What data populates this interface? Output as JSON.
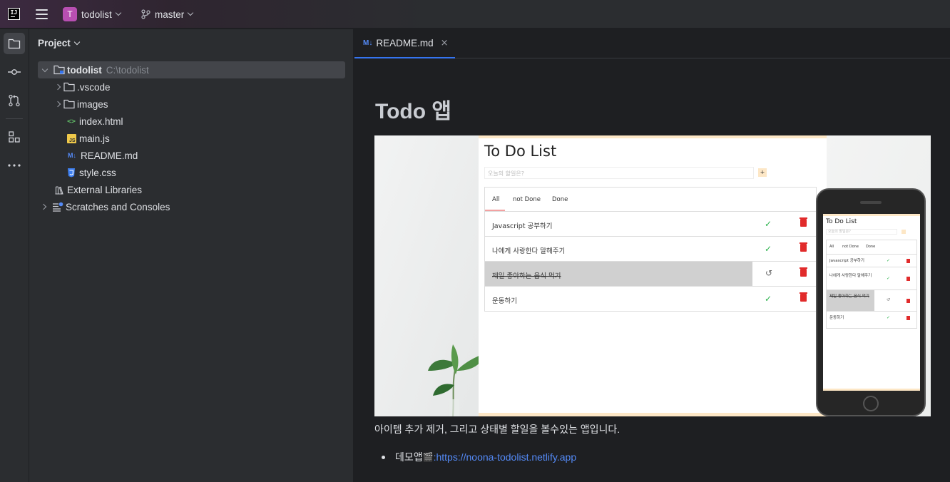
{
  "titlebar": {
    "app_logo": "IJ",
    "project_badge": "T",
    "project_name": "todolist",
    "branch": "master"
  },
  "project_panel": {
    "title": "Project",
    "tree": [
      {
        "label": "todolist",
        "hint": "C:\\todolist",
        "type": "root-folder",
        "expanded": true
      },
      {
        "label": ".vscode",
        "type": "folder"
      },
      {
        "label": "images",
        "type": "folder"
      },
      {
        "label": "index.html",
        "type": "html-file"
      },
      {
        "label": "main.js",
        "type": "js-file"
      },
      {
        "label": "README.md",
        "type": "md-file"
      },
      {
        "label": "style.css",
        "type": "css-file"
      },
      {
        "label": "External Libraries",
        "type": "library"
      },
      {
        "label": "Scratches and Consoles",
        "type": "scratches"
      }
    ]
  },
  "editor": {
    "tab": {
      "icon_text": "M↓",
      "label": "README.md",
      "close": "×"
    },
    "markdown": {
      "h1": "Todo 앱",
      "paragraph": "아이템 추가 제거, 그리고 상태별 할일을 볼수있는 앱입니다.",
      "list_item_prefix": "데모앱",
      "list_item_emoji": "🎬",
      "list_item_sep": ":",
      "list_item_link": "https://noona-todolist.netlify.app"
    },
    "screenshot": {
      "title": "To Do List",
      "placeholder": "오늘의 할일은?",
      "plus": "+",
      "tabs": [
        "All",
        "not Done",
        "Done"
      ],
      "items": [
        {
          "text": "Javascript 공부하기",
          "done": false
        },
        {
          "text": "나에게 사랑한다 말해주기",
          "done": false
        },
        {
          "text": "제일 좋아하는 음식 먹기",
          "done": true
        },
        {
          "text": "운동하기",
          "done": false
        }
      ],
      "phone_items": [
        {
          "text": "Javascript 공부하기",
          "done": false
        },
        {
          "text": "나에게 사랑한다 말해주기",
          "done": false
        },
        {
          "text": "제일 좋아하는 음식 먹기",
          "done": true
        },
        {
          "text": "운동하기",
          "done": false
        }
      ]
    }
  },
  "colors": {
    "accent": "#3574f0",
    "link": "#548af7",
    "project_badge": "#b84fb2",
    "check": "#2bb24c",
    "trash": "#e12b2b"
  }
}
